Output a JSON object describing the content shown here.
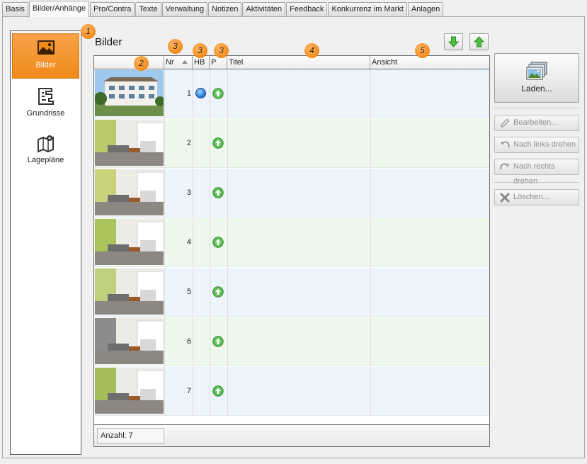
{
  "tabs": [
    "Basis",
    "Bilder/Anhänge",
    "Pro/Contra",
    "Texte",
    "Verwaltung",
    "Notizen",
    "Aktivitäten",
    "Feedback",
    "Konkurrenz im Markt",
    "Anlagen"
  ],
  "active_tab": "Bilder/Anhänge",
  "sidebar": {
    "items": [
      {
        "label": "Bilder",
        "icon": "image-icon",
        "active": true
      },
      {
        "label": "Grundrisse",
        "icon": "floorplan-icon",
        "active": false
      },
      {
        "label": "Lagepläne",
        "icon": "map-pin-icon",
        "active": false
      }
    ]
  },
  "panel_title": "Bilder",
  "grid": {
    "columns": [
      "",
      "Nr",
      "HB",
      "P",
      "Titel",
      "Ansicht"
    ],
    "rows": [
      {
        "nr": "1",
        "hb": true,
        "p": true
      },
      {
        "nr": "2",
        "hb": false,
        "p": true
      },
      {
        "nr": "3",
        "hb": false,
        "p": true
      },
      {
        "nr": "4",
        "hb": false,
        "p": true
      },
      {
        "nr": "5",
        "hb": false,
        "p": true
      },
      {
        "nr": "6",
        "hb": false,
        "p": true
      },
      {
        "nr": "7",
        "hb": false,
        "p": true
      }
    ],
    "footer": "Anzahl: 7"
  },
  "callouts": [
    "1",
    "2",
    "3",
    "3",
    "3",
    "4",
    "5"
  ],
  "actions": {
    "load": "Laden...",
    "edit": "Bearbeiten...",
    "rotate_left": "Nach links drehen",
    "rotate_right": "Nach rechts drehen",
    "delete": "Löschen..."
  },
  "colors": {
    "accent": "#f08a1a",
    "row_blue": "#eef4fb",
    "row_green": "#eff8ec",
    "arrow_green": "#3fae3a"
  }
}
